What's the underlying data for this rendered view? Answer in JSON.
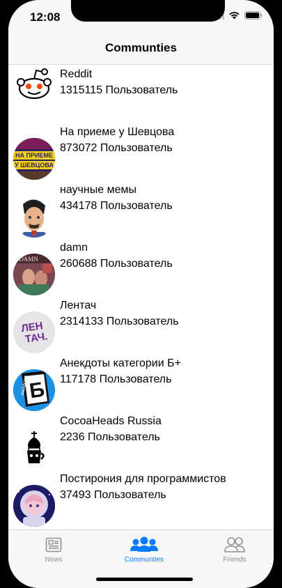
{
  "status_bar": {
    "time": "12:08"
  },
  "nav": {
    "title": "Communties"
  },
  "communities": [
    {
      "name": "Reddit",
      "members": "1315115 Пользователь",
      "icon": "reddit-logo"
    },
    {
      "name": "На приеме у Шевцова",
      "members": "873072 Пользователь",
      "icon": "shevtsov-logo",
      "logo_text": [
        "НА ПРИЕМЕ",
        "У ШЕВЦОВА"
      ]
    },
    {
      "name": "научные мемы",
      "members": "434178 Пользователь",
      "icon": "tesla-portrait"
    },
    {
      "name": "damn",
      "members": "260688 Пользователь",
      "icon": "damn-cover",
      "logo_text": [
        "DAMN"
      ]
    },
    {
      "name": "Лентач",
      "members": "2314133 Пользователь",
      "icon": "lentach-logo",
      "logo_text": [
        "ЛЕН",
        "ТАЧ."
      ]
    },
    {
      "name": "Анекдоты категории Б+",
      "members": "117178 Пользователь",
      "icon": "anekdoty-logo",
      "logo_text": [
        "Б",
        "АНЕКДОТЫ"
      ]
    },
    {
      "name": "CocoaHeads Russia",
      "members": "2236 Пользователь",
      "icon": "cocoaheads-logo"
    },
    {
      "name": "Постирония для программистов",
      "members": "37493 Пользователь",
      "icon": "astronaut-avatar"
    }
  ],
  "tabs": [
    {
      "label": "News",
      "icon": "news-icon",
      "active": false
    },
    {
      "label": "Communties",
      "icon": "people-icon",
      "active": true
    },
    {
      "label": "Friends",
      "icon": "friends-icon",
      "active": false
    }
  ],
  "colors": {
    "accent": "#0a7bff",
    "inactive": "#8e8e93",
    "bar_background": "#f7f7f7"
  }
}
